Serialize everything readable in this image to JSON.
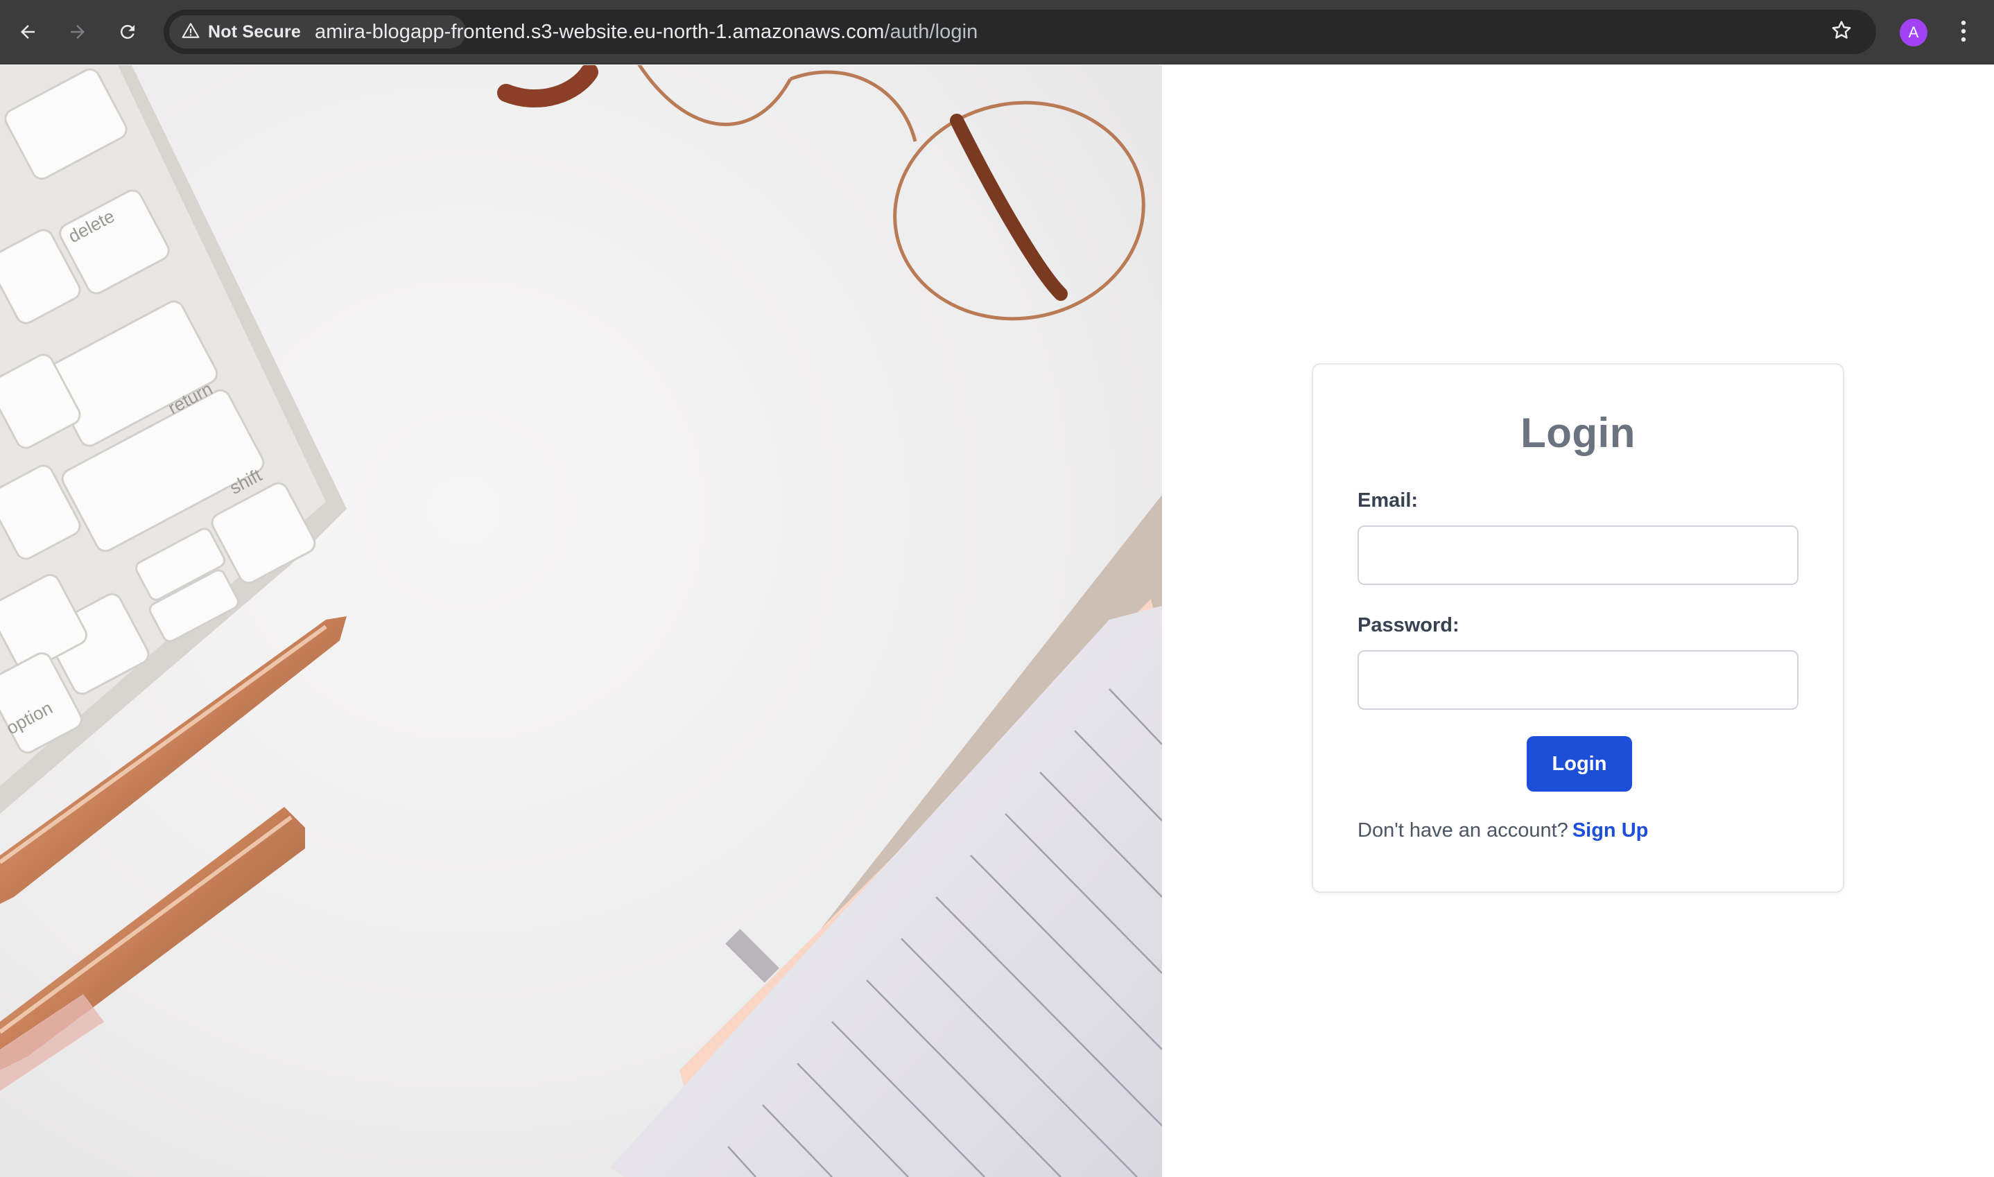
{
  "browser": {
    "security_label": "Not Secure",
    "url_host": "amira-blogapp-frontend.s3-website.eu-north-1.amazonaws.com",
    "url_path": "/auth/login",
    "profile_initial": "A",
    "icons": [
      "back-arrow-icon",
      "forward-arrow-icon",
      "reload-icon",
      "warning-triangle-icon",
      "bookmark-star-icon",
      "more-menu-icon"
    ]
  },
  "login": {
    "title": "Login",
    "email_label": "Email:",
    "email_value": "",
    "password_label": "Password:",
    "password_value": "",
    "submit_label": "Login",
    "signup_prompt": "Don't have an account?",
    "signup_link": "Sign Up"
  },
  "hero_image": {
    "key_labels": [
      "delete",
      "return",
      "shift",
      "option"
    ]
  },
  "colors": {
    "primary": "#1d4ed8",
    "title": "#6b7280",
    "chrome": "#3c3c3c",
    "avatar": "#a142f4"
  }
}
